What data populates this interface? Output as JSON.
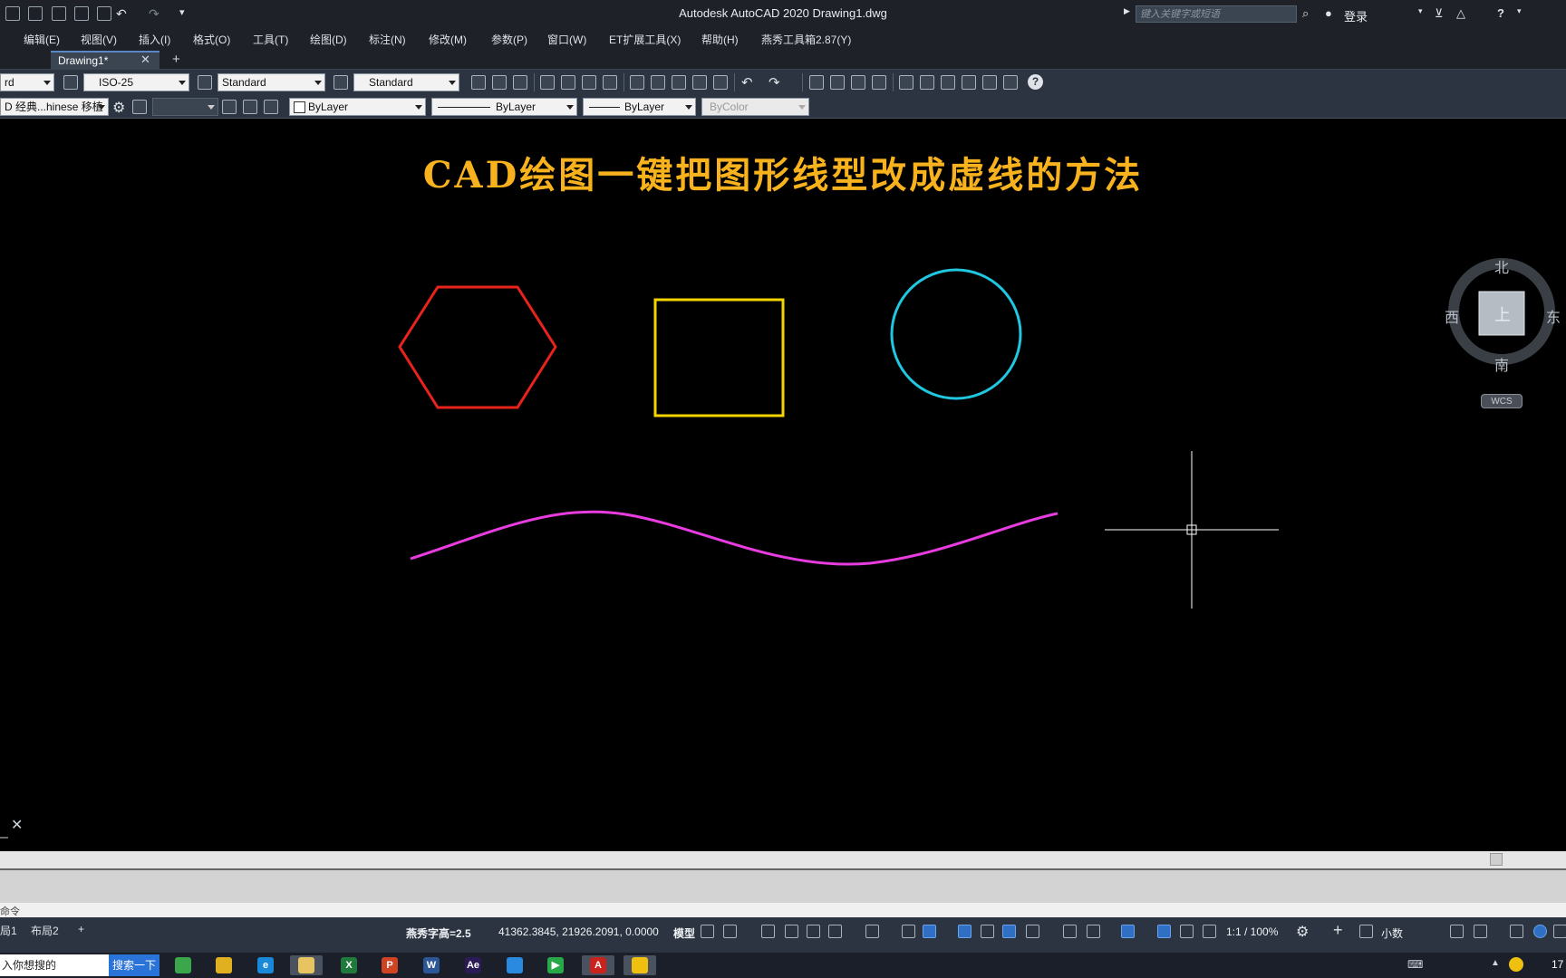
{
  "window": {
    "title": "Autodesk AutoCAD 2020    Drawing1.dwg",
    "search_placeholder": "键入关键字或短语",
    "login": "登录"
  },
  "menu": [
    "编辑(E)",
    "视图(V)",
    "插入(I)",
    "格式(O)",
    "工具(T)",
    "绘图(D)",
    "标注(N)",
    "修改(M)",
    "参数(P)",
    "窗口(W)",
    "ET扩展工具(X)",
    "帮助(H)",
    "燕秀工具箱2.87(Y)"
  ],
  "tabs": {
    "active": "Drawing1*",
    "close_glyph": "✕",
    "add_glyph": "+"
  },
  "toolbar1": {
    "text_style_partial": "rd",
    "dim_style": "ISO-25",
    "table_style": "Standard",
    "multileader_style": "Standard"
  },
  "toolbar2": {
    "workspace": "D 经典...hinese 移植",
    "layer": "",
    "color": "ByLayer",
    "linetype": "ByLayer",
    "lineweight": "ByLayer",
    "plotstyle": "ByColor"
  },
  "drawing": {
    "title": "CAD绘图一键把图形线型改成虚线的方法",
    "shapes": [
      {
        "kind": "hexagon",
        "color": "#e8231c"
      },
      {
        "kind": "square",
        "color": "#f5d400"
      },
      {
        "kind": "circle",
        "color": "#1fc8e0"
      },
      {
        "kind": "spline",
        "color": "#e83ce0"
      }
    ]
  },
  "viewcube": {
    "north": "北",
    "south": "南",
    "west": "西",
    "east": "东",
    "face": "上",
    "wcs": "WCS"
  },
  "command": {
    "prompt": "命令",
    "close_glyph": "✕"
  },
  "layout_tabs": [
    "局1",
    "布局2",
    "+"
  ],
  "status": {
    "text_height": "燕秀字高=2.5",
    "coordinates": "41362.3845, 21926.2091, 0.0000",
    "space": "模型",
    "scale": "1:1 / 100%",
    "units": "小数"
  },
  "taskbar": {
    "search_text": "入你想搜的",
    "search_button": "搜索一下",
    "apps": [
      {
        "name": "browser",
        "label": "",
        "color": "#3aa84a"
      },
      {
        "name": "chrome",
        "label": "",
        "color": "#e0b020"
      },
      {
        "name": "ie",
        "label": "e",
        "color": "#1a8ad8"
      },
      {
        "name": "explorer",
        "label": "",
        "color": "#e8c460"
      },
      {
        "name": "excel",
        "label": "X",
        "color": "#1f7a3c"
      },
      {
        "name": "powerpoint",
        "label": "P",
        "color": "#d04423"
      },
      {
        "name": "word",
        "label": "W",
        "color": "#2b5797"
      },
      {
        "name": "after-effects",
        "label": "Ae",
        "color": "#2a1a55"
      },
      {
        "name": "app-blue",
        "label": "",
        "color": "#2a8ae0"
      },
      {
        "name": "player",
        "label": "▶",
        "color": "#29a84a"
      },
      {
        "name": "autocad",
        "label": "A",
        "color": "#c8231c"
      },
      {
        "name": "yellow-app",
        "label": "",
        "color": "#f0c010"
      }
    ],
    "clock": "17"
  }
}
